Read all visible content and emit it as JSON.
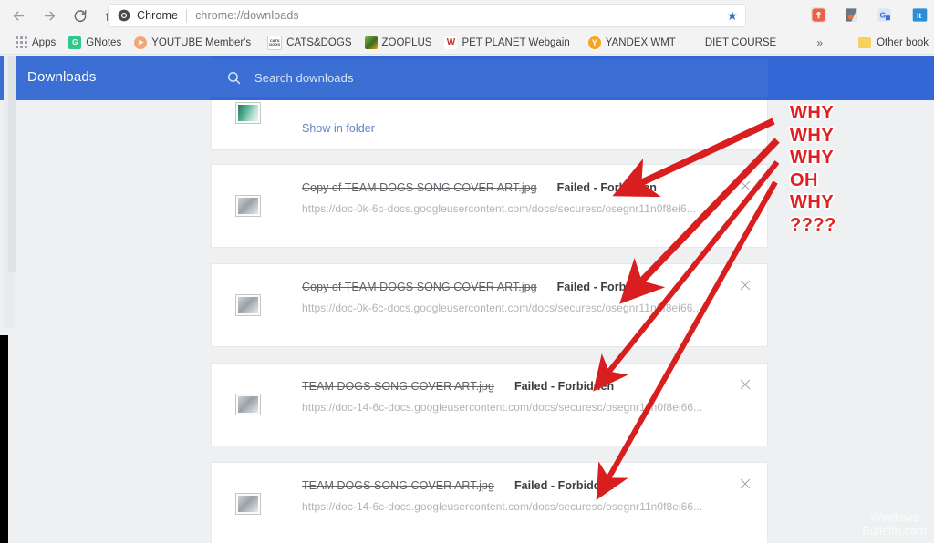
{
  "browser": {
    "nav": {
      "back_icon": "arrow-left-icon",
      "forward_icon": "arrow-right-icon",
      "reload_icon": "reload-icon",
      "home_icon": "home-icon"
    },
    "omnibox": {
      "chip_label": "Chrome",
      "url": "chrome://downloads",
      "favicon": "chrome-logo-icon",
      "star_icon": "bookmark-star-icon"
    },
    "extensions": [
      {
        "name": "gnotes-extension-icon",
        "color": "#2ec98a"
      },
      {
        "name": "password-manager-extension-icon",
        "color": "#e8614c"
      },
      {
        "name": "adblock-extension-icon",
        "color": "#5e6a73"
      },
      {
        "name": "grammar-extension-icon",
        "color": "#4a73c4"
      },
      {
        "name": "it-extension-icon",
        "color": "#2c8fd6"
      }
    ]
  },
  "bookmarks": {
    "apps_label": "Apps",
    "apps_icon": "apps-grid-icon",
    "items": [
      {
        "label": "GNotes",
        "icon": "gnotes-favicon",
        "color": "#2ec98a",
        "glyph": "G"
      },
      {
        "label": "YOUTUBE Member's",
        "icon": "youtube-favicon",
        "color": "#f0a87a",
        "glyph": "▶"
      },
      {
        "label": "CATS&DOGS",
        "icon": "catsdogs-favicon",
        "color": "#ffffff",
        "glyph": "🐾"
      },
      {
        "label": "ZOOPLUS",
        "icon": "zooplus-favicon",
        "color": "#7ab648",
        "glyph": ""
      },
      {
        "label": "PET PLANET Webgain",
        "icon": "petplanet-favicon",
        "color": "#ffffff",
        "glyph": "W"
      },
      {
        "label": "YANDEX WMT",
        "icon": "yandex-favicon",
        "color": "#f5a623",
        "glyph": "Y"
      },
      {
        "label": "DIET COURSE",
        "icon": "none",
        "color": "transparent",
        "glyph": ""
      }
    ],
    "overflow_label": "»",
    "other_bookmarks_label": "Other book",
    "other_bookmarks_icon": "folder-icon"
  },
  "downloads": {
    "title": "Downloads",
    "search": {
      "placeholder": "Search downloads",
      "icon": "search-icon",
      "value": ""
    },
    "items": [
      {
        "kind": "partial",
        "thumb": "image-thumbnail-teal",
        "link_label": "Show in folder",
        "close_icon": "close-icon"
      },
      {
        "kind": "failed",
        "thumb": "image-thumbnail",
        "filename": "Copy of TEAM DOGS SONG COVER ART.jpg",
        "status": "Failed - Forbidden",
        "url": "https://doc-0k-6c-docs.googleusercontent.com/docs/securesc/osegnr11n0f8ei6...",
        "close_icon": "close-icon"
      },
      {
        "kind": "failed",
        "thumb": "image-thumbnail",
        "filename": "Copy of TEAM DOGS SONG COVER ART.jpg",
        "status": "Failed - Forbidden",
        "url": "https://doc-0k-6c-docs.googleusercontent.com/docs/securesc/osegnr11n0f8ei66...",
        "close_icon": "close-icon"
      },
      {
        "kind": "failed",
        "thumb": "image-thumbnail",
        "filename": "TEAM DOGS SONG COVER ART.jpg",
        "status": "Failed - Forbidden",
        "url": "https://doc-14-6c-docs.googleusercontent.com/docs/securesc/osegnr11n0f8ei66...",
        "close_icon": "close-icon"
      },
      {
        "kind": "failed",
        "thumb": "image-thumbnail",
        "filename": "TEAM DOGS SONG COVER ART.jpg",
        "status": "Failed - Forbidden",
        "url": "https://doc-14-6c-docs.googleusercontent.com/docs/securesc/osegnr11n0f8ei66...",
        "close_icon": "close-icon"
      }
    ]
  },
  "annotation": {
    "color": "#e02020",
    "lines": [
      "WHY",
      "WHY",
      "WHY",
      "OH",
      "WHY",
      "????"
    ],
    "arrow_count": 4
  },
  "watermark": {
    "line1": "Windows",
    "line2": "Bulletin.com"
  }
}
